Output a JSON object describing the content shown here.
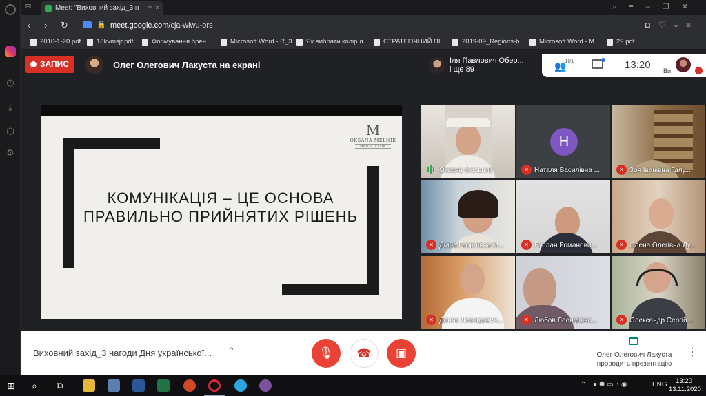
{
  "browser": {
    "tab_title": "Meet: \"Виховний захід_3 н",
    "url_domain": "meet.google.com",
    "url_path": "/cja-wiwu-ors",
    "bookmarks": [
      "2010-1-20.pdf",
      "18kvmsjr.pdf",
      "Формування брен...",
      "Microsoft Word - R_3",
      "Як вибрати колір л...",
      "СТРАТЕГІЧНИЙ ПІ...",
      "2019-09_Regions-b...",
      "Microsoft Word - M...",
      "29.pdf"
    ]
  },
  "meet_header": {
    "record_label": "ЗАПИС",
    "presenter_title": "Олег Олегович Лакуста на екрані",
    "participants_preview": [
      "Іля Павлович Обер...",
      "і ще 89"
    ],
    "people_count": "101",
    "time": "13:20",
    "self_label": "Ви"
  },
  "slide": {
    "logo_mark": "M",
    "logo_name": "OKSANA MELNIK",
    "logo_sub": "MEDIA CLUB",
    "title_line1": "КОМУНІКАЦІЯ – ЦЕ ОСНОВА",
    "title_line2": "ПРАВИЛЬНО ПРИЙНЯТИХ РІШЕНЬ"
  },
  "participants": [
    {
      "name": "Оксана Мельник",
      "muted": false
    },
    {
      "name": "Наталя Василівна ...",
      "muted": true,
      "initial": "Н"
    },
    {
      "name": "Зоя Іванівна Галу...",
      "muted": true
    },
    {
      "name": "Діана Георгіївна М...",
      "muted": true
    },
    {
      "name": "Руслан Романови...",
      "muted": true
    },
    {
      "name": "Олена Олегівна Лу...",
      "muted": true
    },
    {
      "name": "Денис Леонідович...",
      "muted": true
    },
    {
      "name": "Любов Леонідівна...",
      "muted": true
    },
    {
      "name": "Олександр Сергій...",
      "muted": true
    }
  ],
  "bottom_bar": {
    "meeting_name": "Виховний захід_3 нагоди Дня української...",
    "presenting_line1": "Олег Олегович Лакуста",
    "presenting_line2": "проводить презентацію"
  },
  "taskbar": {
    "lang": "ENG",
    "clock_time": "13:20",
    "clock_date": "13.11.2020"
  },
  "colors": {
    "record": "#d93025",
    "control_red": "#ea4335",
    "avatar_purple": "#7e57c2"
  }
}
